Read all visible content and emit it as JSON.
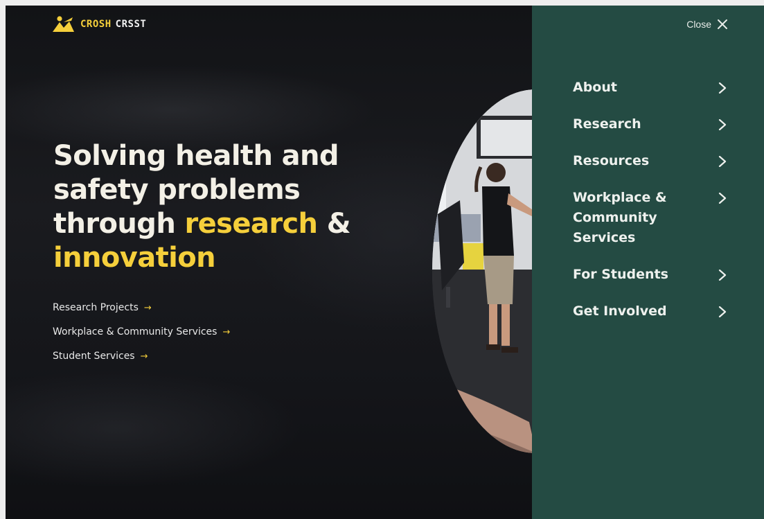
{
  "brand": {
    "primary": "CROSH",
    "secondary": "CRSST",
    "icon": "crosh-logo-icon",
    "accent_color": "#f5cf3b",
    "panel_color": "#244b43"
  },
  "hero": {
    "headline": {
      "line1": "Solving health and",
      "line2": "safety problems",
      "line3_start": "through ",
      "line3_highlight": "research",
      "line3_end": " &",
      "line4_highlight": "innovation"
    },
    "links": [
      {
        "label": "Research Projects",
        "icon": "arrow-right-icon"
      },
      {
        "label": "Workplace & Community Services",
        "icon": "arrow-right-icon"
      },
      {
        "label": "Student Services",
        "icon": "arrow-right-icon"
      }
    ]
  },
  "menu_panel": {
    "close_label": "Close",
    "close_icon": "close-x-icon",
    "items": [
      {
        "label": "About",
        "icon": "chevron-right-icon"
      },
      {
        "label": "Research",
        "icon": "chevron-right-icon"
      },
      {
        "label": "Resources",
        "icon": "chevron-right-icon"
      },
      {
        "label": "Workplace & Community Services",
        "icon": "chevron-right-icon"
      },
      {
        "label": "For Students",
        "icon": "chevron-right-icon"
      },
      {
        "label": "Get Involved",
        "icon": "chevron-right-icon"
      }
    ]
  }
}
